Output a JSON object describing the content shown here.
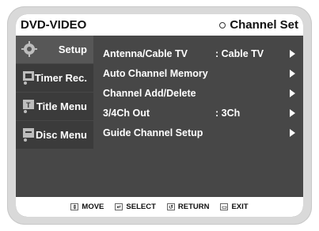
{
  "header": {
    "mode": "DVD-VIDEO",
    "screen_title": "Channel Set"
  },
  "sidebar": {
    "items": [
      {
        "label": "Setup",
        "icon": "gear-icon",
        "active": true
      },
      {
        "label": "Timer Rec.",
        "icon": "timer-icon",
        "active": false
      },
      {
        "label": "Title Menu",
        "icon": "title-menu-icon",
        "active": false
      },
      {
        "label": "Disc Menu",
        "icon": "disc-menu-icon",
        "active": false
      }
    ]
  },
  "menu": {
    "items": [
      {
        "label": "Antenna/Cable TV",
        "value": ": Cable TV"
      },
      {
        "label": "Auto Channel Memory",
        "value": ""
      },
      {
        "label": "Channel Add/Delete",
        "value": ""
      },
      {
        "label": "3/4Ch Out",
        "value": ": 3Ch"
      },
      {
        "label": "Guide Channel Setup",
        "value": ""
      }
    ]
  },
  "footer": {
    "move": "MOVE",
    "select": "SELECT",
    "return": "RETURN",
    "exit": "EXIT"
  },
  "colors": {
    "panel": "#474747",
    "sidebar_active": "#575757",
    "sidebar_inactive": "#3b3b3b",
    "bars": "#ffffff",
    "frame": "#d9d9d9"
  }
}
